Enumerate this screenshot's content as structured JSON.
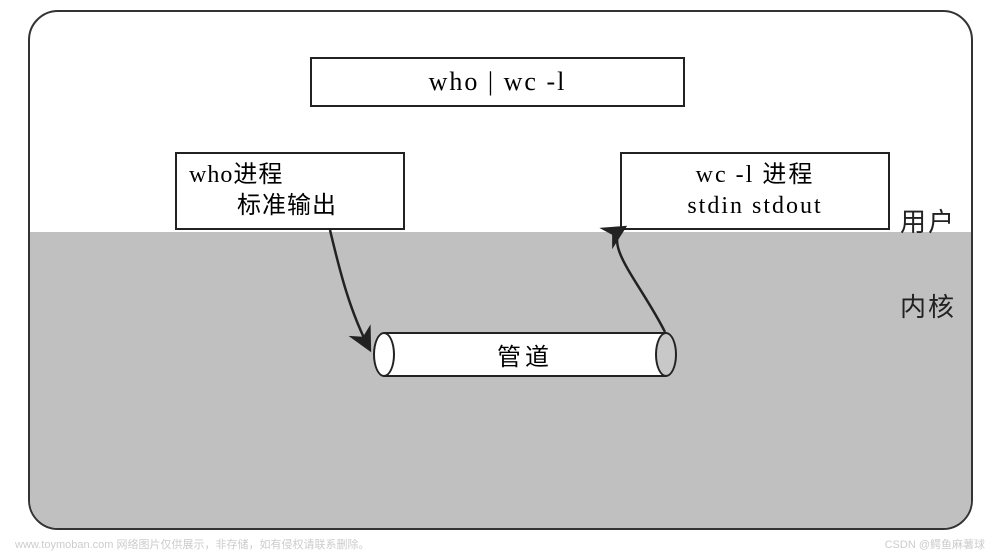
{
  "command": "who | wc -l",
  "who_process": {
    "line1": "who进程",
    "line2": "标准输出"
  },
  "wc_process": {
    "line1": "wc -l 进程",
    "line2": "stdin   stdout"
  },
  "pipe_label": "管道",
  "user_label": "用户",
  "kernel_label": "内核",
  "footer_left": "www.toymoban.com  网络图片仅供展示，非存储，如有侵权请联系删除。",
  "footer_right": "CSDN @鳄鱼麻薯球"
}
